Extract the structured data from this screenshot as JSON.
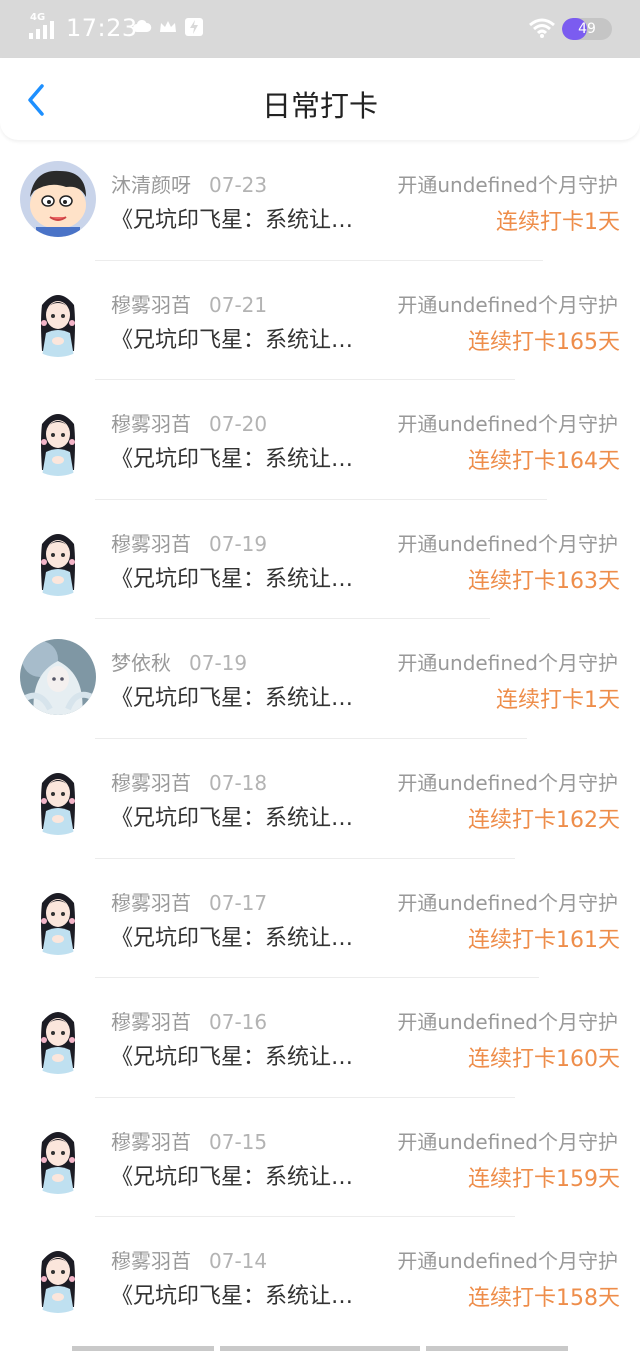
{
  "status_bar": {
    "network": "4G",
    "time": "17:23",
    "battery": "49",
    "battery_level": 0.49,
    "icons": [
      "cloud-icon",
      "crown-icon",
      "flash-icon"
    ]
  },
  "header": {
    "title": "日常打卡",
    "back_icon": "chevron-left-icon"
  },
  "colors": {
    "accent_blue": "#1e90ff",
    "streak_orange": "#ee8d4a",
    "muted": "#999999"
  },
  "checkins": [
    {
      "user": "沐清颜呀",
      "date": "07-23",
      "book": "《兄坑印飞星：系统让…",
      "guard": "开通undefined个月守护",
      "streak": "连续打卡1天",
      "avatar": "cartoon-boy"
    },
    {
      "user": "穆雾羽苩",
      "date": "07-21",
      "book": "《兄坑印飞星：系统让…",
      "guard": "开通undefined个月守护",
      "streak": "连续打卡165天",
      "avatar": "anime-girl"
    },
    {
      "user": "穆雾羽苩",
      "date": "07-20",
      "book": "《兄坑印飞星：系统让…",
      "guard": "开通undefined个月守护",
      "streak": "连续打卡164天",
      "avatar": "anime-girl"
    },
    {
      "user": "穆雾羽苩",
      "date": "07-19",
      "book": "《兄坑印飞星：系统让…",
      "guard": "开通undefined个月守护",
      "streak": "连续打卡163天",
      "avatar": "anime-girl"
    },
    {
      "user": "梦依秋",
      "date": "07-19",
      "book": "《兄坑印飞星：系统让…",
      "guard": "开通undefined个月守护",
      "streak": "连续打卡1天",
      "avatar": "fantasy-girl"
    },
    {
      "user": "穆雾羽苩",
      "date": "07-18",
      "book": "《兄坑印飞星：系统让…",
      "guard": "开通undefined个月守护",
      "streak": "连续打卡162天",
      "avatar": "anime-girl"
    },
    {
      "user": "穆雾羽苩",
      "date": "07-17",
      "book": "《兄坑印飞星：系统让…",
      "guard": "开通undefined个月守护",
      "streak": "连续打卡161天",
      "avatar": "anime-girl"
    },
    {
      "user": "穆雾羽苩",
      "date": "07-16",
      "book": "《兄坑印飞星：系统让…",
      "guard": "开通undefined个月守护",
      "streak": "连续打卡160天",
      "avatar": "anime-girl"
    },
    {
      "user": "穆雾羽苩",
      "date": "07-15",
      "book": "《兄坑印飞星：系统让…",
      "guard": "开通undefined个月守护",
      "streak": "连续打卡159天",
      "avatar": "anime-girl"
    },
    {
      "user": "穆雾羽苩",
      "date": "07-14",
      "book": "《兄坑印飞星：系统让…",
      "guard": "开通undefined个月守护",
      "streak": "连续打卡158天",
      "avatar": "anime-girl"
    }
  ]
}
